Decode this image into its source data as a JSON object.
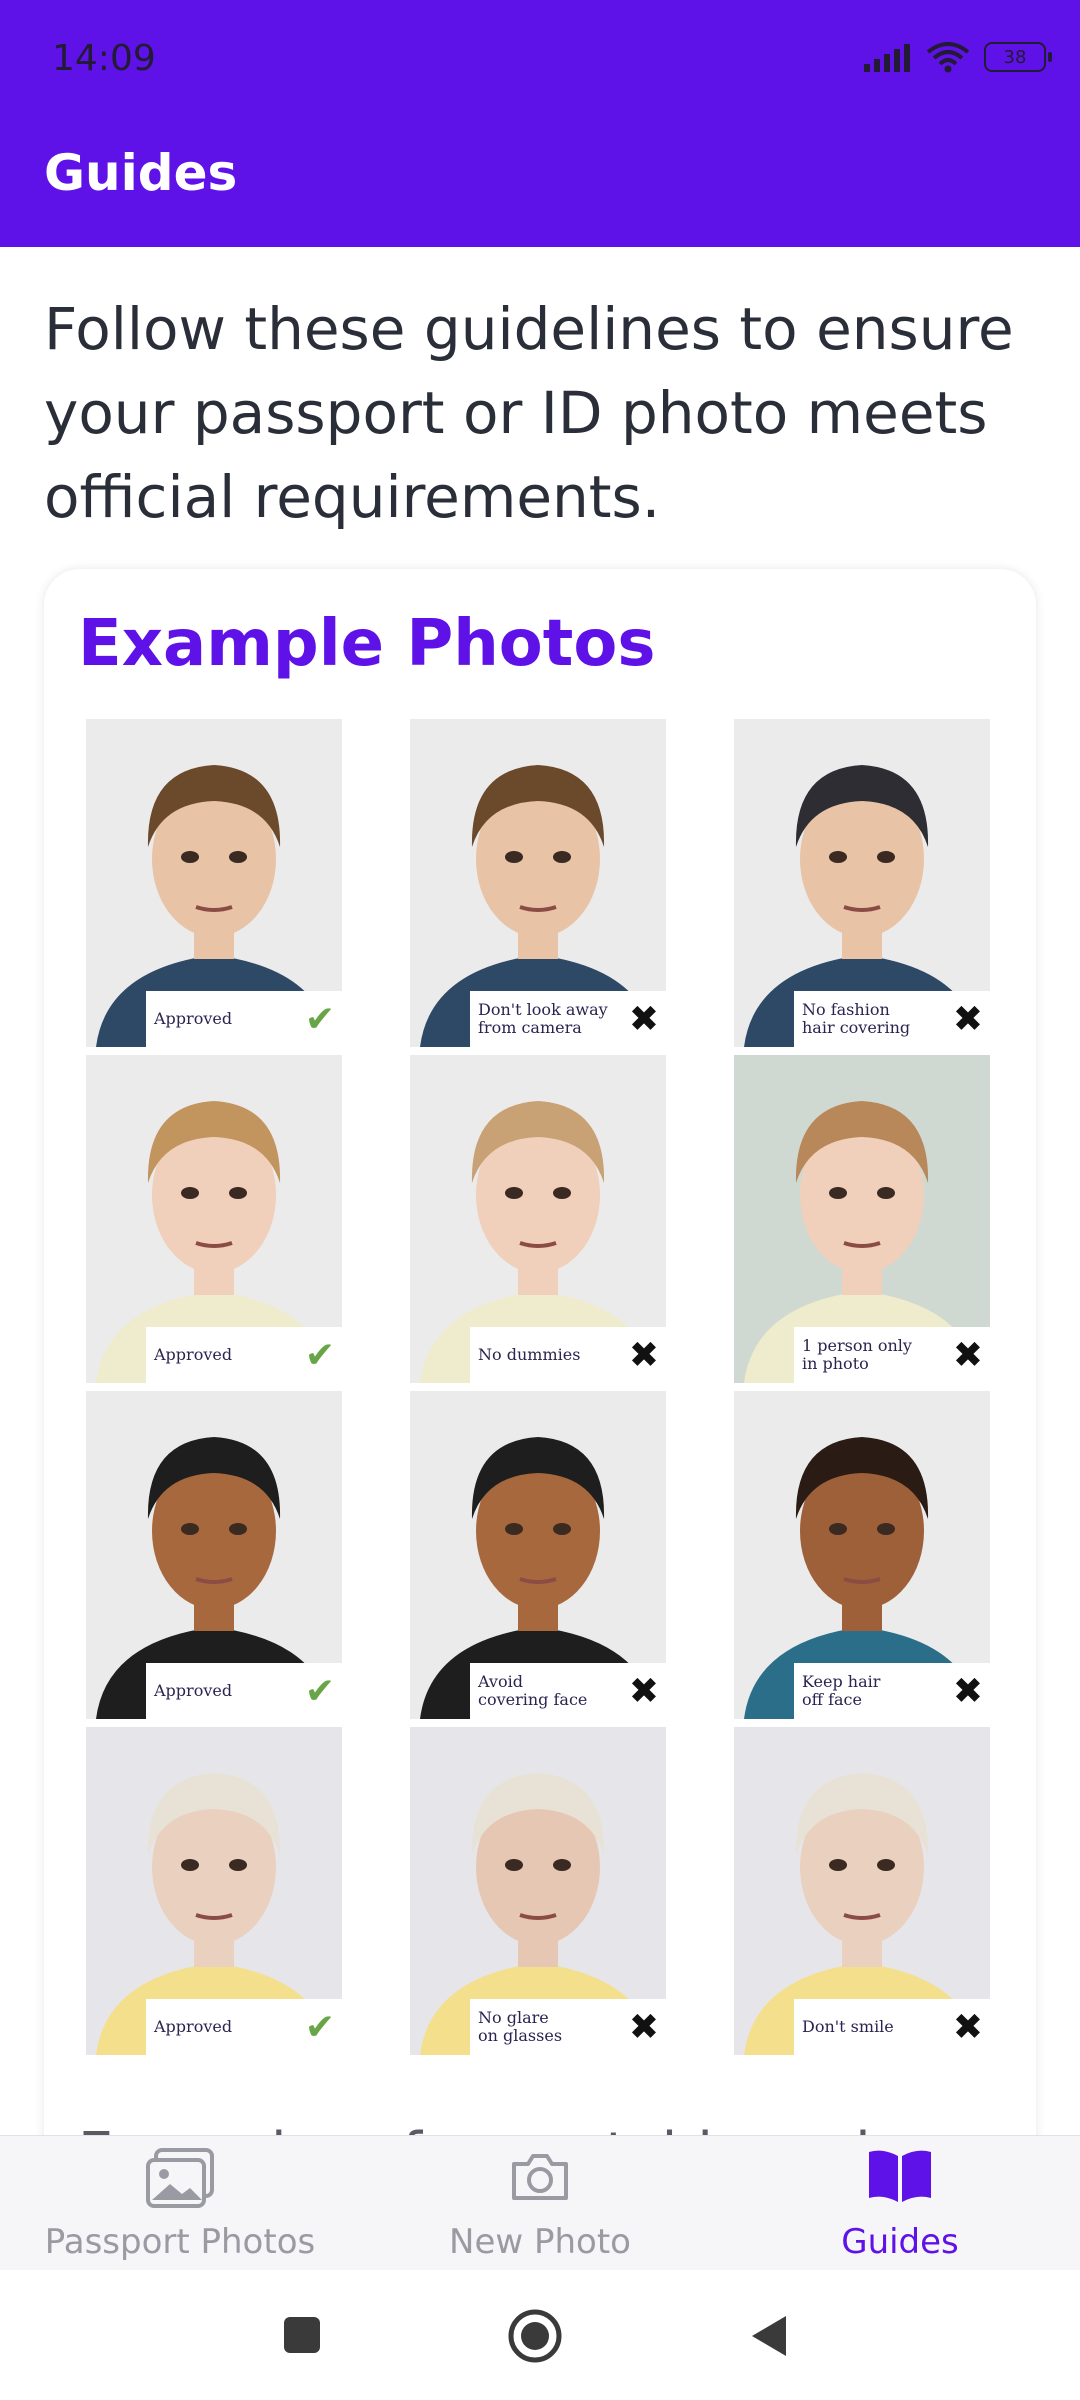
{
  "status_bar": {
    "time": "14:09",
    "battery": "38"
  },
  "app_bar": {
    "title": "Guides"
  },
  "intro_text": "Follow these guidelines to ensure your passport or ID photo meets official requirements.",
  "example_card": {
    "title": "Example Photos",
    "photos": [
      {
        "label": "Approved",
        "approved": true
      },
      {
        "label": "Don't look away\nfrom camera",
        "approved": false
      },
      {
        "label": "No fashion\nhair covering",
        "approved": false
      },
      {
        "label": "Approved",
        "approved": true
      },
      {
        "label": "No dummies",
        "approved": false
      },
      {
        "label": "1 person only\nin photo",
        "approved": false
      },
      {
        "label": "Approved",
        "approved": true
      },
      {
        "label": "Avoid\ncovering face",
        "approved": false
      },
      {
        "label": "Keep hair\noff face",
        "approved": false
      },
      {
        "label": "Approved",
        "approved": true
      },
      {
        "label": "No glare\non glasses",
        "approved": false
      },
      {
        "label": "Don't smile",
        "approved": false
      }
    ],
    "next_heading": "Examples of acceptable and"
  },
  "bottom_nav": {
    "items": [
      {
        "label": "Passport Photos",
        "icon": "image-icon",
        "active": false
      },
      {
        "label": "New Photo",
        "icon": "camera-icon",
        "active": false
      },
      {
        "label": "Guides",
        "icon": "book-icon",
        "active": true
      }
    ]
  },
  "colors": {
    "primary": "#5f12e8",
    "inactive": "#9a9aa2",
    "approved": "#6aa449"
  }
}
